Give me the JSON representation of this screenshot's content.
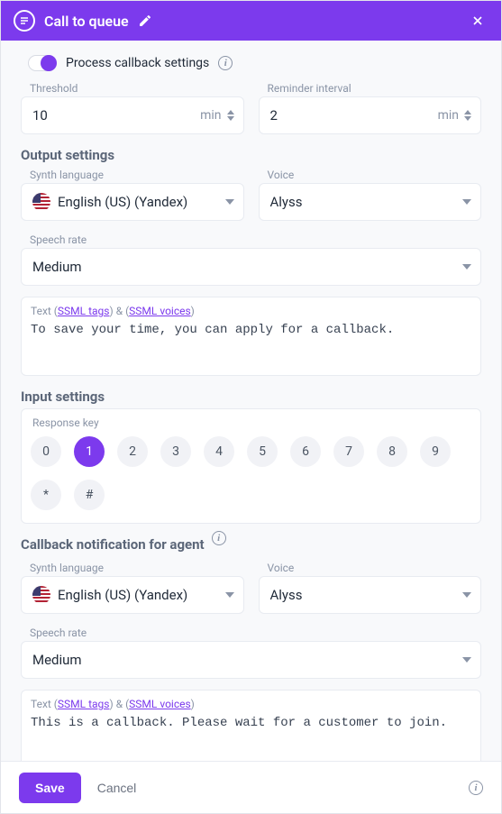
{
  "header": {
    "title": "Call to queue"
  },
  "toggle": {
    "label": "Process callback settings"
  },
  "threshold": {
    "label": "Threshold",
    "value": "10",
    "unit": "min"
  },
  "reminder": {
    "label": "Reminder interval",
    "value": "2",
    "unit": "min"
  },
  "output": {
    "section": "Output settings",
    "synth_label": "Synth language",
    "synth_value": "English (US) (Yandex)",
    "voice_label": "Voice",
    "voice_value": "Alyss",
    "rate_label": "Speech rate",
    "rate_value": "Medium",
    "text_hint_prefix": "Text (",
    "text_hint_tags": "SSML tags",
    "text_hint_mid": ") & (",
    "text_hint_voices": "SSML voices",
    "text_hint_suffix": ")",
    "text_value": "To save your time, you can apply for a callback."
  },
  "input": {
    "section": "Input settings",
    "response_label": "Response key",
    "keys": [
      "0",
      "1",
      "2",
      "3",
      "4",
      "5",
      "6",
      "7",
      "8",
      "9",
      "*",
      "#"
    ],
    "active_key": "1"
  },
  "callback": {
    "section": "Callback notification for agent",
    "synth_label": "Synth language",
    "synth_value": "English (US) (Yandex)",
    "voice_label": "Voice",
    "voice_value": "Alyss",
    "rate_label": "Speech rate",
    "rate_value": "Medium",
    "text_hint_prefix": "Text (",
    "text_hint_tags": "SSML tags",
    "text_hint_mid": ") & (",
    "text_hint_voices": "SSML voices",
    "text_hint_suffix": ")",
    "text_value": "This is a callback. Please wait for a customer to join."
  },
  "footer": {
    "save": "Save",
    "cancel": "Cancel"
  }
}
